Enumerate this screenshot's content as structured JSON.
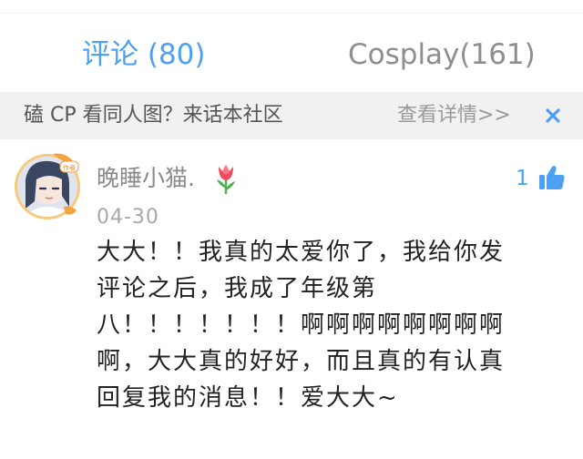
{
  "tabs": [
    {
      "label": "评论 (80)",
      "active": true
    },
    {
      "label": "Cosplay(161)",
      "active": false
    }
  ],
  "banner": {
    "text": "磕 CP 看同人图？来话本社区",
    "link": "查看详情>>",
    "close_icon": "close-x-icon"
  },
  "comment": {
    "author_badge": "作者",
    "username": "晚睡小猫.",
    "username_emoji": "tulip",
    "like_count": "1",
    "date": "04-30",
    "body_lines": [
      "大大！！我真的太爱你了，我给你发",
      "评论之后，我成了年级第",
      "八！！！！！！！啊啊啊啊啊啊啊啊",
      "啊，大大真的好好，而且真的有认真",
      "回复我的消息！！爱大大~"
    ]
  },
  "colors": {
    "accent": "#4da0f2",
    "banner_bg": "#f1f1f1",
    "muted": "#8e8e8e",
    "text": "#222222"
  }
}
